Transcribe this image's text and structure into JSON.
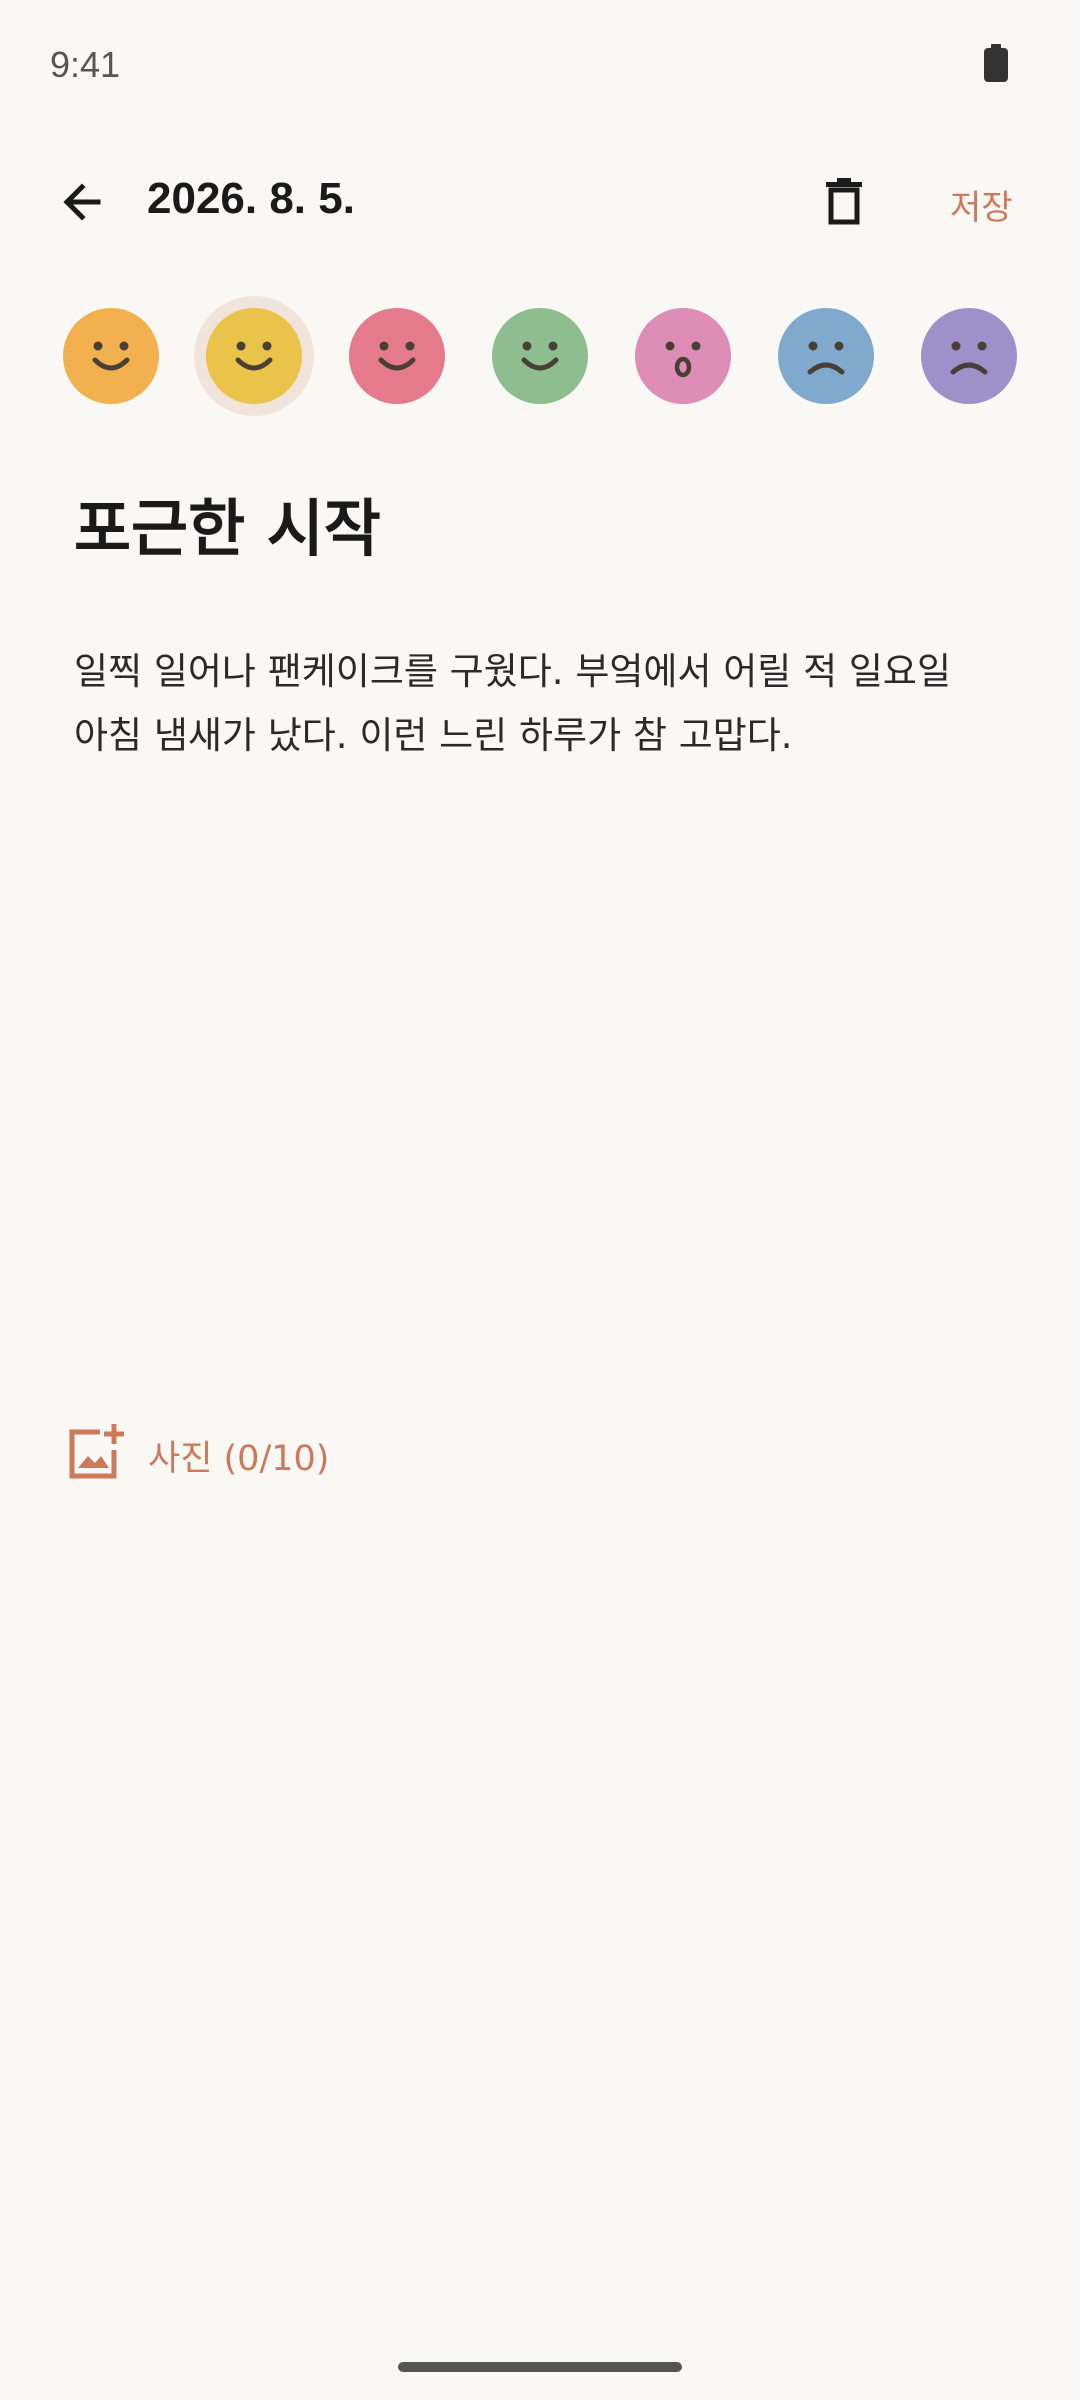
{
  "status_bar": {
    "time": "9:41"
  },
  "header": {
    "date": "2026. 8. 5.",
    "save_label": "저장"
  },
  "moods": [
    {
      "name": "happy-orange",
      "color": "#F2B04F",
      "expression": "smile",
      "selected": false
    },
    {
      "name": "happy-yellow",
      "color": "#E9C34A",
      "expression": "smile",
      "selected": true
    },
    {
      "name": "happy-pink",
      "color": "#E57A8C",
      "expression": "smile",
      "selected": false
    },
    {
      "name": "happy-green",
      "color": "#8EBD90",
      "expression": "smile",
      "selected": false
    },
    {
      "name": "surprised-pink",
      "color": "#DD8DB6",
      "expression": "surprised",
      "selected": false
    },
    {
      "name": "sad-blue",
      "color": "#7FA9CD",
      "expression": "frown",
      "selected": false
    },
    {
      "name": "sad-purple",
      "color": "#9E90C8",
      "expression": "frown",
      "selected": false
    }
  ],
  "entry": {
    "title": "포근한 시작",
    "body_line_1": "일찍 일어나 팬케이크를 구웠다. 부엌에서 어릴 적 일요일",
    "body_line_2": "아침 냄새가 났다. 이런 느린 하루가 참 고맙다."
  },
  "photos": {
    "label": "사진 (0/10)"
  },
  "colors": {
    "accent": "#CE7A5A",
    "background": "#FAF8F5"
  }
}
